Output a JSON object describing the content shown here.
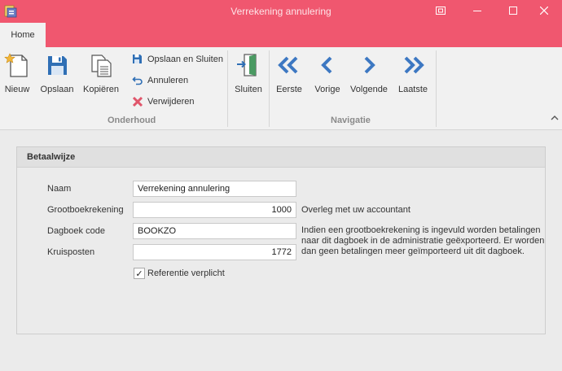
{
  "window": {
    "title": "Verrekening annulering"
  },
  "ribbon": {
    "tab": "Home",
    "onderhoud": {
      "label": "Onderhoud",
      "nieuw": "Nieuw",
      "opslaan": "Opslaan",
      "kopieren": "Kopiëren",
      "opslaan_sluiten": "Opslaan en Sluiten",
      "annuleren": "Annuleren",
      "verwijderen": "Verwijderen"
    },
    "sluiten": "Sluiten",
    "navigatie": {
      "label": "Navigatie",
      "eerste": "Eerste",
      "vorige": "Vorige",
      "volgende": "Volgende",
      "laatste": "Laatste"
    }
  },
  "form": {
    "section_title": "Betaalwijze",
    "naam": {
      "label": "Naam",
      "value": "Verrekening annulering"
    },
    "grootboek": {
      "label": "Grootboekrekening",
      "value": "1000",
      "hint": "Overleg met uw accountant"
    },
    "dagboek": {
      "label": "Dagboek code",
      "value": "BOOKZO"
    },
    "kruisposten": {
      "label": "Kruisposten",
      "value": "1772"
    },
    "note_lines": [
      "Indien een grootboekrekening is ingevuld worden betalingen",
      "naar dit dagboek in de administratie geëxporteerd. Er worden",
      "dan geen betalingen meer geïmporteerd uit dit dagboek."
    ],
    "referentie": {
      "label": "Referentie verplicht",
      "checked": true,
      "mark": "✓"
    }
  },
  "colors": {
    "accent": "#f0576f",
    "nav_blue": "#3d78c2"
  },
  "icons": [
    "app-icon",
    "restore-icon",
    "minimize-icon",
    "maximize-icon",
    "close-icon",
    "new-document-icon",
    "save-icon",
    "copy-icon",
    "save-close-icon",
    "undo-icon",
    "delete-icon",
    "exit-door-icon",
    "first-icon",
    "previous-icon",
    "next-icon",
    "last-icon",
    "collapse-ribbon-icon"
  ]
}
